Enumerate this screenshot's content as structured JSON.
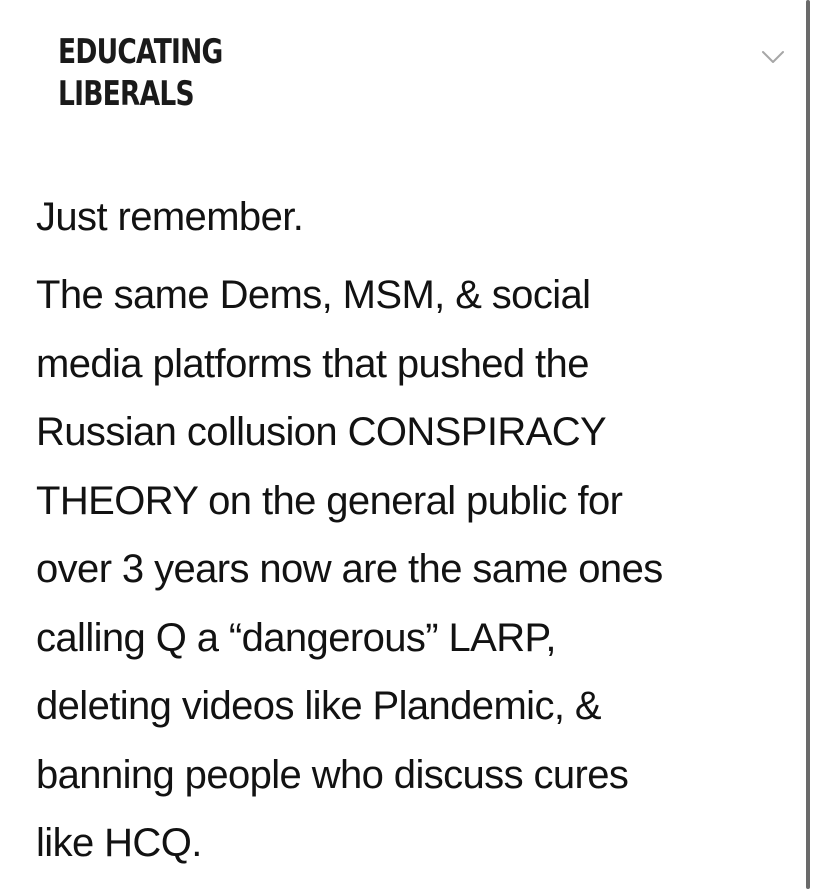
{
  "header": {
    "brand_line_1": "EDUCATING",
    "brand_line_2": "LIBERALS",
    "expand_icon": "chevron-down-icon"
  },
  "post": {
    "intro": "Just remember.",
    "lines": [
      "The same Dems, MSM, & social",
      "media platforms that pushed the",
      "Russian collusion CONSPIRACY",
      "THEORY on the general public for",
      "over 3 years now are the same ones",
      "calling Q a “dangerous” LARP,",
      "deleting videos like Plandemic, &",
      "banning people who discuss cures",
      "like HCQ."
    ]
  },
  "colors": {
    "background": "#ffffff",
    "text": "#121212",
    "chevron": "#a7a7a7",
    "scrollbar": "#6a6a6a"
  }
}
